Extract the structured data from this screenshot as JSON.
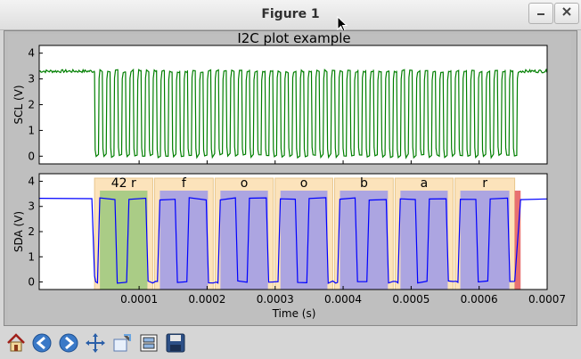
{
  "window": {
    "title": "Figure 1"
  },
  "toolbar": {
    "tools": [
      "home",
      "back",
      "forward",
      "pan",
      "zoom",
      "configure-subplots",
      "save"
    ]
  },
  "chart_data": [
    {
      "type": "line",
      "title": "I2C plot example",
      "ylabel": "SCL (V)",
      "ylim": [
        -0.3,
        4.3
      ],
      "yticks": [
        "0",
        "1",
        "2",
        "3",
        "4"
      ],
      "xlim": [
        -4.69e-05,
        0.0007
      ],
      "series": [
        {
          "name": "SCL",
          "color": "#007f00",
          "high": 3.3,
          "low": 0.0,
          "idle_until": 3.45e-05,
          "clock_start": 3.45e-05,
          "clock_end": 0.000661,
          "cycles": 55
        }
      ]
    },
    {
      "type": "line",
      "ylabel": "SDA (V)",
      "xlabel": "Time (s)",
      "ylim": [
        -0.3,
        4.3
      ],
      "yticks": [
        "0",
        "1",
        "2",
        "3",
        "4"
      ],
      "xlim": [
        -4.69e-05,
        0.0007
      ],
      "xticks": [
        "0.0001",
        "0.0002",
        "0.0003",
        "0.0004",
        "0.0005",
        "0.0006",
        "0.0007"
      ],
      "series": [
        {
          "name": "SDA",
          "color": "#0000ff"
        }
      ],
      "annotations": [
        {
          "label": "42 r",
          "x0": 3.45e-05,
          "x1": 0.0001201,
          "fill": "#9bc87c"
        },
        {
          "label": "f",
          "x0": 0.0001227,
          "x1": 0.000209,
          "fill": "#9e9ae8"
        },
        {
          "label": "o",
          "x0": 0.0002117,
          "x1": 0.0002973,
          "fill": "#9e9ae8"
        },
        {
          "label": "o",
          "x0": 0.0003,
          "x1": 0.0003848,
          "fill": "#9e9ae8"
        },
        {
          "label": "b",
          "x0": 0.0003875,
          "x1": 0.0004737,
          "fill": "#9e9ae8"
        },
        {
          "label": "a",
          "x0": 0.0004764,
          "x1": 0.0005617,
          "fill": "#9e9ae8"
        },
        {
          "label": "r",
          "x0": 0.0005645,
          "x1": 0.0006523,
          "fill": "#9e9ae8"
        }
      ],
      "stop_marker": {
        "x0": 0.0006523,
        "x1": 0.000661,
        "fill": "#e87070"
      }
    }
  ]
}
